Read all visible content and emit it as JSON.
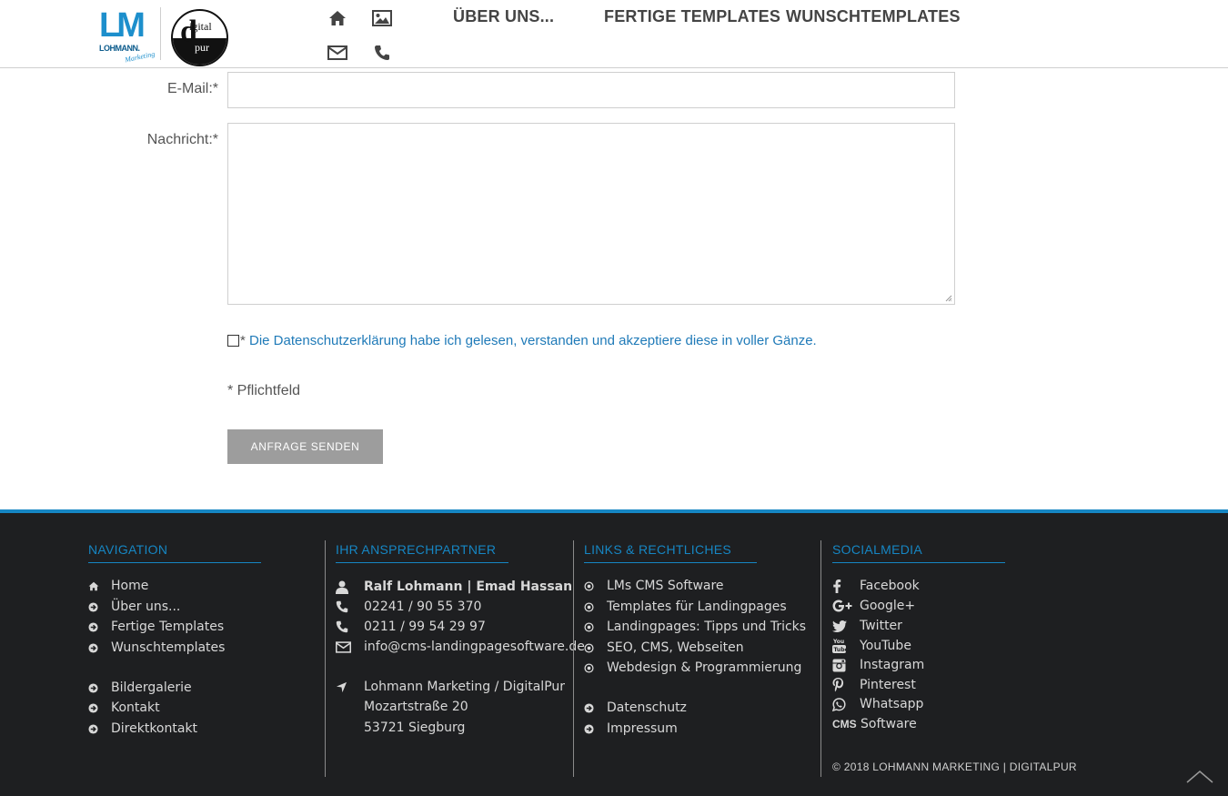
{
  "header": {
    "logo_lm": {
      "big": "LM",
      "name": "LOHMANN.",
      "sub": "Marketing"
    },
    "logo_dp": {
      "letter": "d",
      "top": "igital",
      "bottom": "pur"
    },
    "icons": [
      "home-icon",
      "image-icon",
      "envelope-icon",
      "phone-icon"
    ],
    "nav": [
      "ÜBER UNS...",
      "FERTIGE TEMPLATES",
      "WUNSCHTEMPLATES"
    ]
  },
  "form": {
    "email_label": "E-Mail:*",
    "email_value": "",
    "message_label": "Nachricht:*",
    "message_value": "",
    "consent_star": "*",
    "consent_text": " Die Datenschutzerklärung habe ich gelesen, verstanden und akzeptiere diese in voller Gänze.",
    "consent_checked": false,
    "required_note": "* Pflichtfeld",
    "submit_label": "ANFRAGE SENDEN"
  },
  "footer": {
    "accent_color": "#1686c3",
    "background": "#1e1f21",
    "navigation": {
      "title": "NAVIGATION",
      "items": [
        {
          "icon": "home-icon",
          "label": "Home"
        },
        {
          "icon": "arrow-circle-icon",
          "label": "Über uns..."
        },
        {
          "icon": "arrow-circle-icon",
          "label": "Fertige Templates"
        },
        {
          "icon": "arrow-circle-icon",
          "label": "Wunschtemplates"
        },
        {
          "icon": "arrow-circle-icon",
          "label": "Bildergalerie"
        },
        {
          "icon": "arrow-circle-icon",
          "label": "Kontakt"
        },
        {
          "icon": "arrow-circle-icon",
          "label": "Direktkontakt"
        }
      ]
    },
    "contact": {
      "title": "IHR ANSPRECHPARTNER",
      "person": "Ralf Lohmann | Emad Hassan",
      "phone1": "02241 / 90 55 370",
      "phone2": "0211 / 99 54 29 97",
      "email": "info@cms-landingpagesoftware.de",
      "company": "Lohmann Marketing / DigitalPur",
      "street": "Mozartstraße 20",
      "city": "53721 Siegburg"
    },
    "links": {
      "title": "LINKS & RECHTLICHES",
      "items": [
        "LMs CMS Software",
        "Templates für Landingpages",
        "Landingpages: Tipps und Tricks",
        "SEO, CMS, Webseiten",
        "Webdesign & Programmierung",
        "Datenschutz",
        "Impressum"
      ]
    },
    "social": {
      "title": "SOCIALMEDIA",
      "items": [
        {
          "icon": "facebook-icon",
          "label": "Facebook"
        },
        {
          "icon": "google-plus-icon",
          "label": "Google+"
        },
        {
          "icon": "twitter-icon",
          "label": "Twitter"
        },
        {
          "icon": "youtube-icon",
          "label": "YouTube"
        },
        {
          "icon": "instagram-icon",
          "label": "Instagram"
        },
        {
          "icon": "pinterest-icon",
          "label": "Pinterest"
        },
        {
          "icon": "whatsapp-icon",
          "label": "Whatsapp"
        },
        {
          "icon": "cms-icon",
          "label": "Software",
          "icon_text": "CMS"
        }
      ]
    },
    "copyright": "© 2018 LOHMANN MARKETING | DIGITALPUR"
  }
}
